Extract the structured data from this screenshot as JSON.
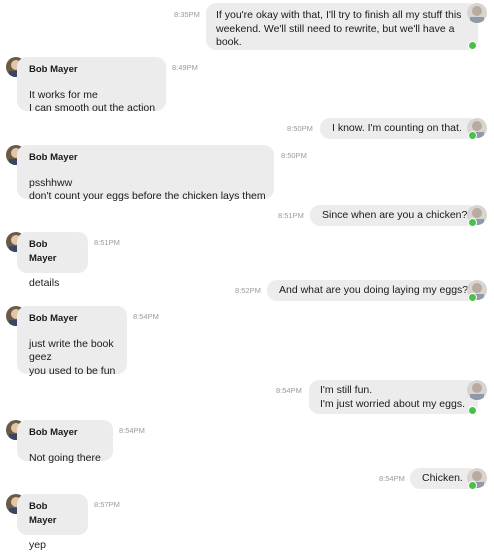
{
  "contact_name": "Bob Mayer",
  "messages": [
    {
      "from": "me",
      "time": "8:35PM",
      "lines": [
        "If you're okay with that, I'll try to finish all my stuff this",
        "weekend.  We'll still need to rewrite, but we'll have a",
        "book."
      ]
    },
    {
      "from": "bob",
      "time": "8:49PM",
      "lines": [
        "It works for me",
        "I can smooth out the action"
      ]
    },
    {
      "from": "me",
      "time": "8:50PM",
      "lines": [
        "I know.  I'm counting on that."
      ]
    },
    {
      "from": "bob",
      "time": "8:50PM",
      "lines": [
        "psshhww",
        "don't count your eggs before the chicken lays them"
      ]
    },
    {
      "from": "me",
      "time": "8:51PM",
      "lines": [
        "Since when are you a chicken?"
      ]
    },
    {
      "from": "bob",
      "time": "8:51PM",
      "lines": [
        "details"
      ]
    },
    {
      "from": "me",
      "time": "8:52PM",
      "lines": [
        "And what are you doing laying my eggs?"
      ]
    },
    {
      "from": "bob",
      "time": "8:54PM",
      "lines": [
        "just write the book",
        "geez",
        "you used to be fun"
      ]
    },
    {
      "from": "me",
      "time": "8:54PM",
      "lines": [
        "I'm still fun.",
        "I'm just worried about my eggs."
      ]
    },
    {
      "from": "bob",
      "time": "8:54PM",
      "lines": [
        "Not going there"
      ]
    },
    {
      "from": "me",
      "time": "8:54PM",
      "lines": [
        "Chicken."
      ]
    },
    {
      "from": "bob",
      "time": "8:57PM",
      "lines": [
        "yep"
      ]
    }
  ],
  "colors": {
    "bubble": "#ececec",
    "online": "#4bbf4b",
    "timestamp": "#9a9a9a"
  },
  "icons": {
    "bob_avatar": "avatar-photo",
    "my_avatar": "avatar-photo",
    "status": "online-status-icon"
  }
}
